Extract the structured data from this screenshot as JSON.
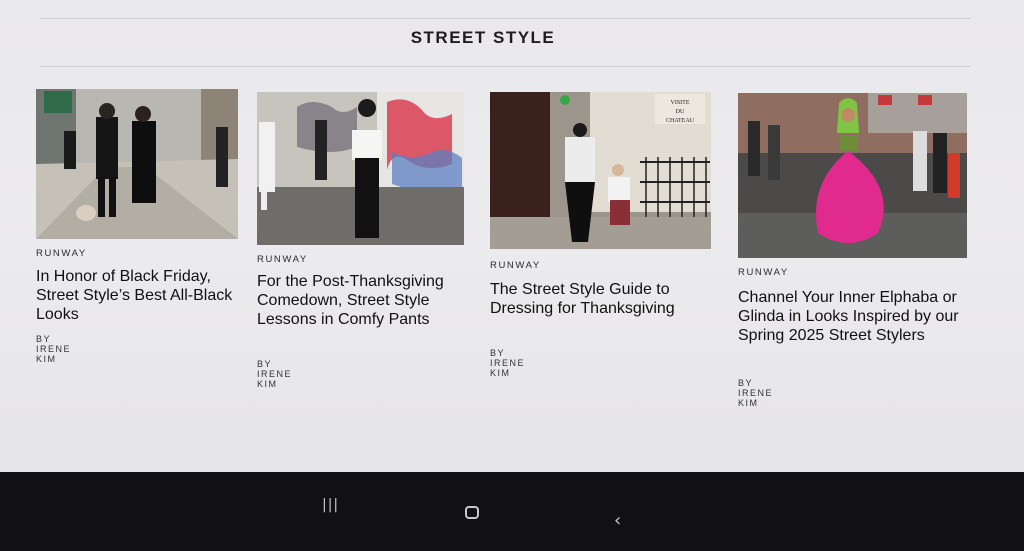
{
  "section": {
    "title": "STREET STYLE"
  },
  "articles": [
    {
      "category": "RUNWAY",
      "headline": "In Honor of Black Friday, Street Style’s Best All-Black Looks",
      "byline": "BY IRENE KIM"
    },
    {
      "category": "RUNWAY",
      "headline": "For the Post-Thanksgiving Comedown, Street Style Lessons in Comfy Pants",
      "byline": "BY IRENE KIM"
    },
    {
      "category": "RUNWAY",
      "headline": "The Street Style Guide to Dressing for Thanksgiving",
      "byline": "BY IRENE KIM"
    },
    {
      "category": "RUNWAY",
      "headline": "Channel Your Inner Elphaba or Glinda in Looks Inspired by our Spring 2025 Street Stylers",
      "byline": "BY IRENE KIM"
    }
  ],
  "image_signs": {
    "card3_sign": "VISITE DU CHATEAU"
  },
  "navbar": {
    "recents_icon": "recents-icon",
    "home_icon": "home-icon",
    "back_icon": "back-icon",
    "recents_glyph": "|||",
    "back_glyph": "‹"
  },
  "colors": {
    "background": "#ecebee",
    "text": "#111111",
    "rule": "#cfced3",
    "navbar": "#111113"
  }
}
